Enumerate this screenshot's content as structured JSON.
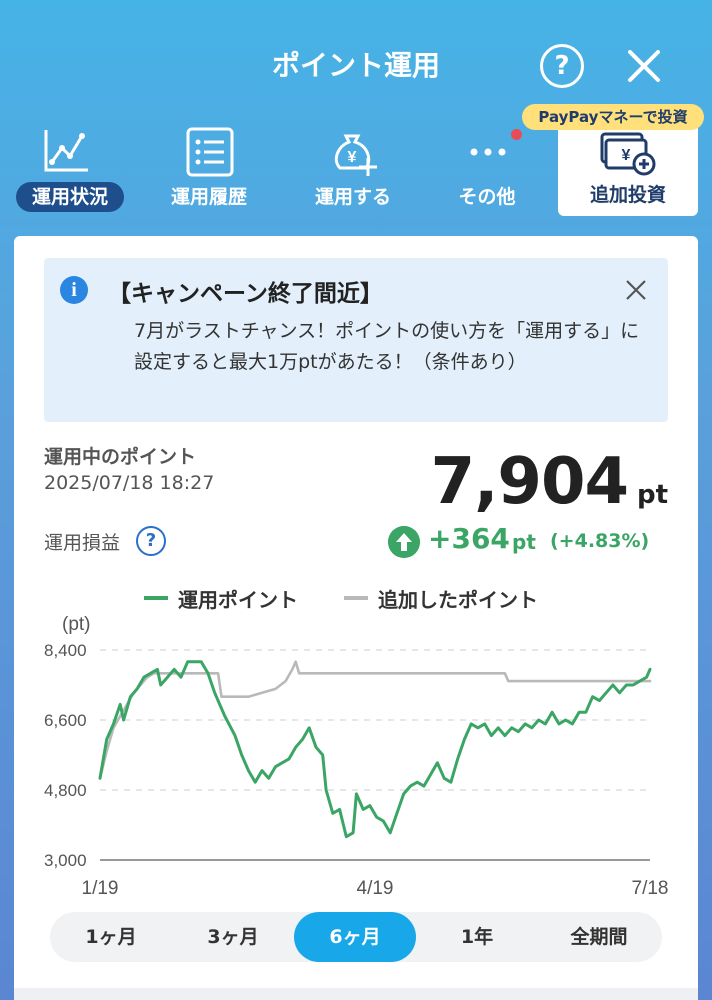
{
  "header": {
    "title": "ポイント運用",
    "help_label": "?"
  },
  "nav": {
    "items": [
      {
        "label": "運用状況",
        "icon": "line-chart-icon",
        "active": true
      },
      {
        "label": "運用履歴",
        "icon": "list-icon",
        "active": false
      },
      {
        "label": "運用する",
        "icon": "money-bag-plus-icon",
        "active": false
      },
      {
        "label": "その他",
        "icon": "more-dots-icon",
        "active": false
      }
    ],
    "invest": {
      "label": "追加投資",
      "badge": "PayPayマネーで投資",
      "icon": "yen-bill-plus-icon"
    }
  },
  "notice": {
    "title": "【キャンペーン終了間近】",
    "body": "7月がラストチャンス！ポイントの使い方を「運用する」に設定すると最大1万ptがあたる！（条件あり）"
  },
  "summary": {
    "label": "運用中のポイント",
    "date": "2025/07/18 18:27",
    "value": "7,904",
    "unit": "pt",
    "pl_label": "運用損益",
    "pl_value": "+364",
    "pl_unit": "pt",
    "pl_percent": "(+4.83%)"
  },
  "colors": {
    "accent": "#18a7e8",
    "gain": "#3aa564",
    "navy": "#1f4e8c",
    "added_line": "#b9b9b9"
  },
  "chart_data": {
    "type": "line",
    "ylabel": "(pt)",
    "ylim": [
      3000,
      8400
    ],
    "yticks": [
      "3,000",
      "4,800",
      "6,600",
      "8,400"
    ],
    "xticks": [
      "1/19",
      "4/19",
      "7/18"
    ],
    "grid": true,
    "legend": "top",
    "series": [
      {
        "name": "運用ポイント",
        "color": "#3aa564",
        "points": [
          [
            0,
            5100
          ],
          [
            2,
            6100
          ],
          [
            4,
            6500
          ],
          [
            6,
            7000
          ],
          [
            7,
            6600
          ],
          [
            9,
            7200
          ],
          [
            11,
            7400
          ],
          [
            13,
            7700
          ],
          [
            15,
            7800
          ],
          [
            17,
            7900
          ],
          [
            18,
            7500
          ],
          [
            20,
            7700
          ],
          [
            22,
            7900
          ],
          [
            24,
            7700
          ],
          [
            26,
            8100
          ],
          [
            30,
            8100
          ],
          [
            32,
            7800
          ],
          [
            34,
            7300
          ],
          [
            37,
            6700
          ],
          [
            40,
            6200
          ],
          [
            42,
            5700
          ],
          [
            44,
            5300
          ],
          [
            46,
            5000
          ],
          [
            48,
            5300
          ],
          [
            50,
            5100
          ],
          [
            52,
            5400
          ],
          [
            54,
            5500
          ],
          [
            56,
            5600
          ],
          [
            58,
            5900
          ],
          [
            60,
            6100
          ],
          [
            62,
            6400
          ],
          [
            64,
            5900
          ],
          [
            66,
            5700
          ],
          [
            67,
            4800
          ],
          [
            69,
            4200
          ],
          [
            71,
            4300
          ],
          [
            73,
            3600
          ],
          [
            75,
            3700
          ],
          [
            76,
            4700
          ],
          [
            78,
            4300
          ],
          [
            80,
            4400
          ],
          [
            82,
            4100
          ],
          [
            84,
            4000
          ],
          [
            86,
            3700
          ],
          [
            88,
            4200
          ],
          [
            90,
            4700
          ],
          [
            92,
            4900
          ],
          [
            94,
            5000
          ],
          [
            96,
            4900
          ],
          [
            98,
            5200
          ],
          [
            100,
            5500
          ],
          [
            102,
            5100
          ],
          [
            104,
            5000
          ],
          [
            106,
            5600
          ],
          [
            108,
            6100
          ],
          [
            110,
            6500
          ],
          [
            112,
            6400
          ],
          [
            114,
            6500
          ],
          [
            116,
            6200
          ],
          [
            118,
            6400
          ],
          [
            120,
            6200
          ],
          [
            122,
            6400
          ],
          [
            124,
            6300
          ],
          [
            126,
            6500
          ],
          [
            128,
            6400
          ],
          [
            130,
            6600
          ],
          [
            132,
            6500
          ],
          [
            134,
            6800
          ],
          [
            136,
            6500
          ],
          [
            138,
            6600
          ],
          [
            140,
            6500
          ],
          [
            142,
            6800
          ],
          [
            144,
            6800
          ],
          [
            146,
            7200
          ],
          [
            148,
            7100
          ],
          [
            150,
            7300
          ],
          [
            152,
            7500
          ],
          [
            154,
            7300
          ],
          [
            156,
            7500
          ],
          [
            158,
            7500
          ],
          [
            160,
            7600
          ],
          [
            162,
            7700
          ],
          [
            163,
            7904
          ]
        ]
      },
      {
        "name": "追加したポイント",
        "color": "#b9b9b9",
        "points": [
          [
            0,
            5100
          ],
          [
            2,
            5800
          ],
          [
            4,
            6400
          ],
          [
            6,
            6700
          ],
          [
            8,
            7000
          ],
          [
            10,
            7300
          ],
          [
            12,
            7500
          ],
          [
            14,
            7700
          ],
          [
            16,
            7800
          ],
          [
            35,
            7800
          ],
          [
            36,
            7200
          ],
          [
            44,
            7200
          ],
          [
            48,
            7300
          ],
          [
            52,
            7400
          ],
          [
            55,
            7600
          ],
          [
            57,
            7900
          ],
          [
            58,
            8100
          ],
          [
            59,
            7800
          ],
          [
            120,
            7800
          ],
          [
            121,
            7600
          ],
          [
            163,
            7600
          ]
        ]
      }
    ],
    "x_max": 163
  },
  "periods": [
    {
      "label": "1ヶ月",
      "active": false
    },
    {
      "label": "3ヶ月",
      "active": false
    },
    {
      "label": "6ヶ月",
      "active": true
    },
    {
      "label": "1年",
      "active": false
    },
    {
      "label": "全期間",
      "active": false
    }
  ]
}
